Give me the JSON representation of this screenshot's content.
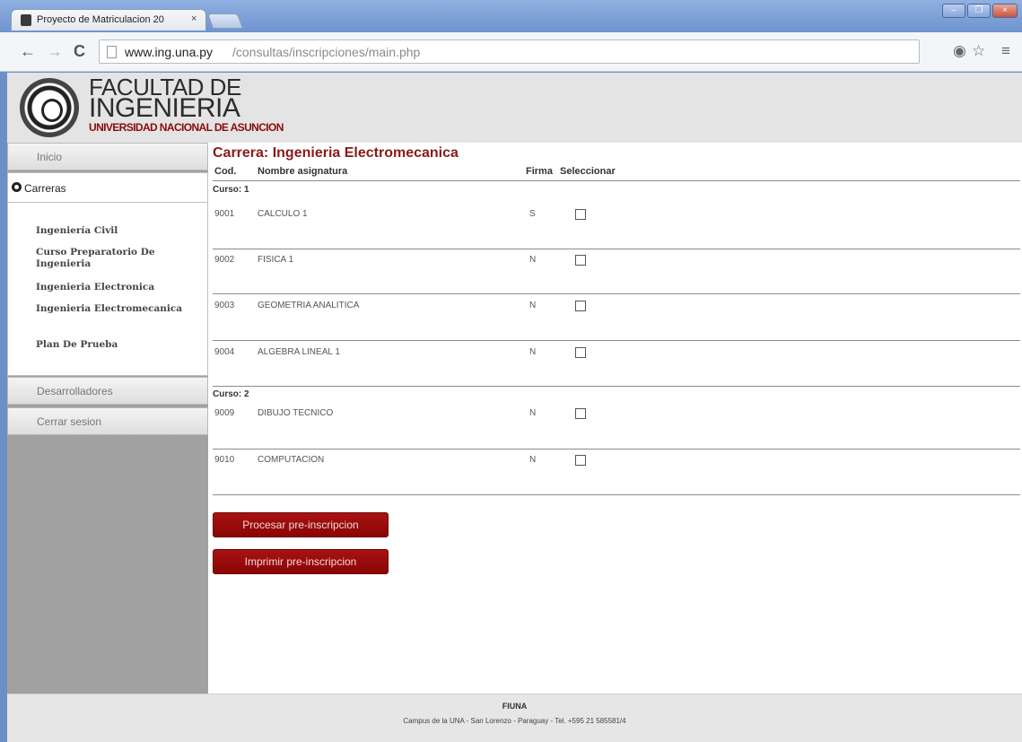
{
  "browser": {
    "tab_title": "Proyecto de Matriculacion 20",
    "tab_close": "×",
    "url_host": "www.ing.una.py",
    "url_path": "/consultas/inscripciones/main.php",
    "window_controls": [
      "–",
      "❐",
      "×"
    ]
  },
  "header": {
    "brand_line1": "FACULTAD DE",
    "brand_line2": "INGENIERIA",
    "brand_line3": "UNIVERSIDAD NACIONAL DE ASUNCION"
  },
  "sidebar": {
    "inicio": "Inicio",
    "carreras": "Carreras",
    "careers": [
      "Ingeniería Civil",
      "Curso Preparatorio De Ingenieria",
      "Ingenieria Electronica",
      "Ingenieria Electromecanica",
      "Plan De Prueba"
    ],
    "desarrolladores": "Desarrolladores",
    "cerrar_sesion": "Cerrar sesion"
  },
  "main": {
    "career_title": "Carrera: Ingenieria Electromecanica",
    "columns": {
      "cod": "Cod.",
      "nombre": "Nombre asignatura",
      "firma": "Firma",
      "seleccionar": "Seleccionar"
    },
    "courses": [
      {
        "label": "Curso: 1",
        "subjects": [
          {
            "cod": "9001",
            "nombre": "CALCULO 1",
            "firma": "S",
            "selected": false
          },
          {
            "cod": "9002",
            "nombre": "FISICA 1",
            "firma": "N",
            "selected": false
          },
          {
            "cod": "9003",
            "nombre": "GEOMETRIA ANALITICA",
            "firma": "N",
            "selected": false
          },
          {
            "cod": "9004",
            "nombre": "ALGEBRA LINEAL 1",
            "firma": "N",
            "selected": false
          }
        ]
      },
      {
        "label": "Curso: 2",
        "subjects": [
          {
            "cod": "9009",
            "nombre": "DIBUJO TECNICO",
            "firma": "N",
            "selected": false
          },
          {
            "cod": "9010",
            "nombre": "COMPUTACION",
            "firma": "N",
            "selected": false
          }
        ]
      }
    ],
    "btn_procesar": "Procesar pre-inscripcion",
    "btn_imprimir": "Imprimir pre-inscripcion"
  },
  "footer": {
    "line1": "FIUNA",
    "line2": "Campus de la UNA - San Lorenzo - Paraguay - Tel. +595 21 585581/4"
  }
}
